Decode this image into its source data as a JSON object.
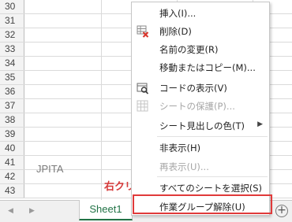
{
  "rows": [
    "30",
    "31",
    "32",
    "33",
    "34",
    "35",
    "36",
    "37",
    "38",
    "39",
    "40",
    "41",
    "42",
    "43"
  ],
  "cell_watermark": "JPITA",
  "annotation": "右クリック",
  "sheet_tab": "Sheet1",
  "nav": {
    "prev": "◀",
    "next": "▶"
  },
  "add_sheet": "+",
  "menu": {
    "insert": "挿入(I)...",
    "delete": "削除(D)",
    "rename": "名前の変更(R)",
    "move_copy": "移動またはコピー(M)...",
    "view_code": "コードの表示(V)",
    "protect_sheet": "シートの保護(P)...",
    "tab_color": "シート見出しの色(T)",
    "hide": "非表示(H)",
    "unhide": "再表示(U)...",
    "select_all": "すべてのシートを選択(S)",
    "ungroup": "作業グループ解除(U)"
  },
  "colors": {
    "highlight": "#e03a3a",
    "sheet_tab": "#217346"
  }
}
